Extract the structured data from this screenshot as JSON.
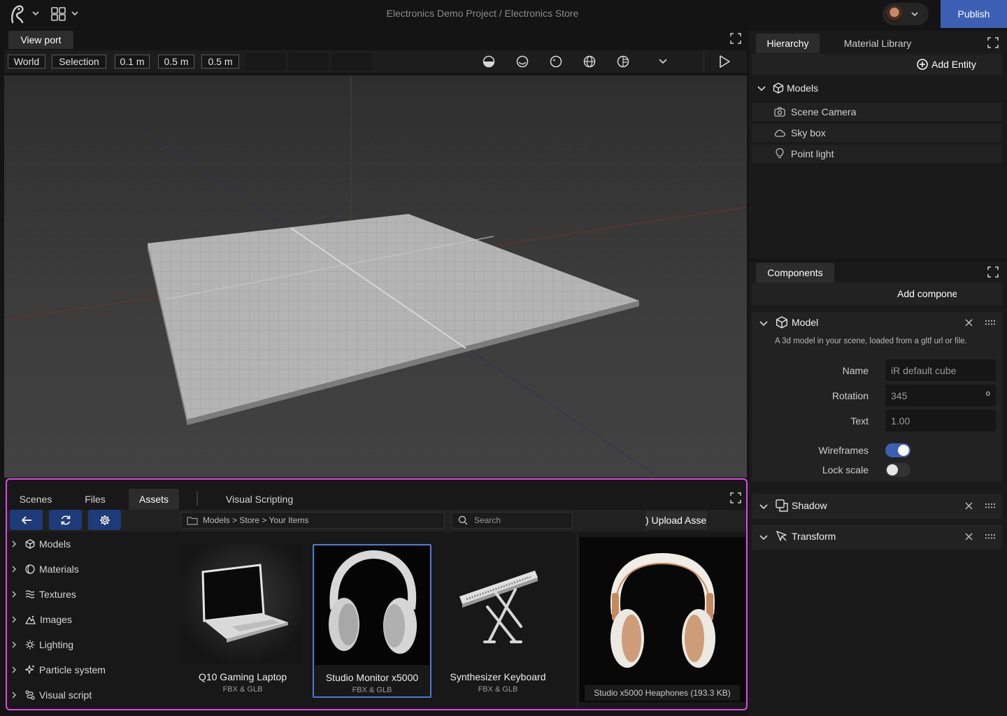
{
  "window": {
    "title": "Electronics Demo Project / Electronics Store",
    "publish_label": "Publish"
  },
  "viewport": {
    "tab_label": "View port",
    "toolbar": {
      "space": "World",
      "mode": "Selection",
      "snap_translate": "0.1 m",
      "snap_rotate": "0.5 m",
      "snap_scale": "0.5 m"
    }
  },
  "hierarchy": {
    "tabs": [
      {
        "label": "Hierarchy"
      },
      {
        "label": "Material Library"
      }
    ],
    "add_entity_label": "Add Entity",
    "root_label": "Models",
    "items": [
      {
        "label": "Scene Camera",
        "icon": "camera-icon"
      },
      {
        "label": "Sky box",
        "icon": "cloud-icon"
      },
      {
        "label": "Point light",
        "icon": "lightbulb-icon"
      }
    ]
  },
  "components": {
    "tab_label": "Components",
    "add_component_label": "Add compone",
    "model": {
      "title": "Model",
      "description": "A 3d model in your scene, loaded from a gltf url or file.",
      "name_label": "Name",
      "name_value": "iR default cube",
      "rotation_label": "Rotation",
      "rotation_value": "345",
      "rotation_unit": "o",
      "text_label": "Text",
      "text_value": "1.00",
      "wireframes_label": "Wireframes",
      "wireframes_on": true,
      "lockscale_label": "Lock scale",
      "lockscale_on": false
    },
    "shadow_title": "Shadow",
    "transform_title": "Transform"
  },
  "browser": {
    "tabs": [
      {
        "label": "Scenes"
      },
      {
        "label": "Files"
      },
      {
        "label": "Assets"
      },
      {
        "label": "Visual Scripting"
      }
    ],
    "active_tab": "Assets",
    "breadcrumb": "Models > Store > Your Items",
    "search_placeholder": "Search",
    "upload_label": ") Upload Asse",
    "categories": [
      {
        "label": "Models",
        "icon": "cube-icon"
      },
      {
        "label": "Materials",
        "icon": "material-icon"
      },
      {
        "label": "Textures",
        "icon": "texture-icon"
      },
      {
        "label": "Images",
        "icon": "image-icon"
      },
      {
        "label": "Lighting",
        "icon": "sun-icon"
      },
      {
        "label": "Particle system",
        "icon": "sparkle-icon"
      },
      {
        "label": "Visual script",
        "icon": "script-icon"
      }
    ],
    "assets": [
      {
        "title": "Q10 Gaming Laptop",
        "format": "FBX & GLB"
      },
      {
        "title": "Studio Monitor x5000",
        "format": "FBX & GLB",
        "selected": true
      },
      {
        "title": "Synthesizer Keyboard",
        "format": "FBX & GLB"
      }
    ],
    "preview_caption": "Studio x5000 Heaphones (193.3 KB)"
  },
  "colors": {
    "accent": "#3c5fb4",
    "highlight_border": "#e04ae6",
    "selected_border": "#4a78d6"
  }
}
